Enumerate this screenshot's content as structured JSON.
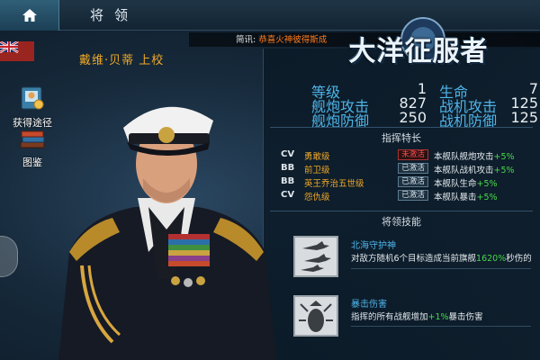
{
  "header": {
    "title": "将领",
    "home_icon": "home-icon"
  },
  "news": {
    "label": "简讯:",
    "message": "恭喜火神彼得斯成"
  },
  "commander": {
    "name": "戴维·贝蒂 上校"
  },
  "side": {
    "obtain_label": "获得途径",
    "codex_label": "图鉴"
  },
  "logo": {
    "text": "大洋征服者",
    "tag": "将"
  },
  "stats": [
    {
      "key": "等级",
      "value": "1"
    },
    {
      "key": "生命",
      "value": "7"
    },
    {
      "key": "舰炮攻击",
      "value": "827"
    },
    {
      "key": "战机攻击",
      "value": "125"
    },
    {
      "key": "舰炮防御",
      "value": "250"
    },
    {
      "key": "战机防御",
      "value": "125"
    }
  ],
  "traits_title": "指挥特长",
  "traits": [
    {
      "cls": "CV",
      "name": "勇敢级",
      "status": "未激活",
      "active": false,
      "desc": "本舰队舰炮攻击",
      "bonus": "+5%"
    },
    {
      "cls": "BB",
      "name": "前卫级",
      "status": "已激活",
      "active": true,
      "desc": "本舰队战机攻击",
      "bonus": "+5%"
    },
    {
      "cls": "BB",
      "name": "英王乔治五世级",
      "status": "已激活",
      "active": true,
      "desc": "本舰队生命",
      "bonus": "+5%"
    },
    {
      "cls": "CV",
      "name": "怨仇级",
      "status": "已激活",
      "active": true,
      "desc": "本舰队暴击",
      "bonus": "+5%"
    }
  ],
  "skills_title": "将领技能",
  "skills": [
    {
      "name": "北海守护神",
      "desc_pre": "对敌方随机6个目标造成当前旗舰",
      "highlight": "1620%",
      "desc_post": "秒伤的",
      "icon": "aircraft-icon"
    },
    {
      "name": "暴击伤害",
      "desc_pre": "指挥的所有战舰增加",
      "highlight": "+1%",
      "desc_post": "暴击伤害",
      "icon": "bomb-icon"
    }
  ],
  "colors": {
    "accent_gold": "#f0a928",
    "stat_blue": "#4fb4e8",
    "bonus_green": "#48d84a",
    "inactive_red": "#ff4a4a"
  }
}
